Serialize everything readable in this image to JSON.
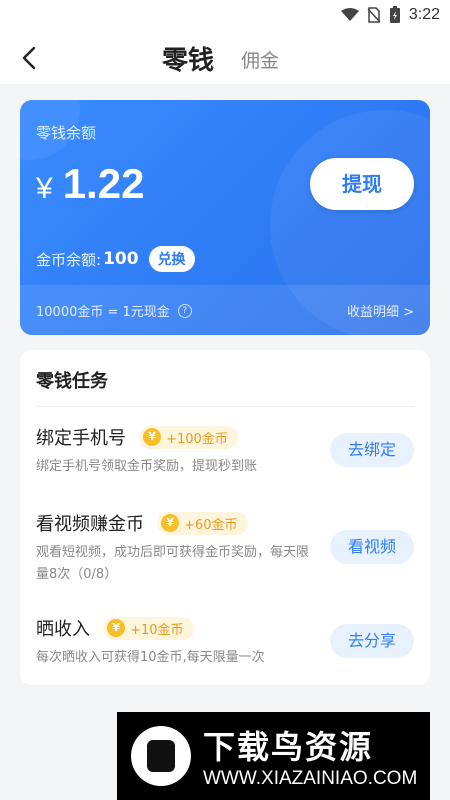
{
  "status_bar": {
    "time": "3:22",
    "icons": [
      "wifi-icon",
      "no-sim-icon",
      "battery-charging-icon"
    ]
  },
  "header": {
    "title": "零钱",
    "tab_commission": "佣金",
    "back_icon": "chevron-left-icon"
  },
  "balance_card": {
    "label": "零钱余额",
    "currency": "¥",
    "amount": "1.22",
    "withdraw_label": "提现",
    "coin_label": "金币余额:",
    "coin_value": "100",
    "exchange_label": "兑换",
    "rate_text": "10000金币 = 1元现金",
    "detail_link": "收益明细 >",
    "accent_color": "#2f7cf6"
  },
  "tasks": {
    "title": "零钱任务",
    "items": [
      {
        "name": "绑定手机号",
        "reward": "+100金币",
        "desc": "绑定手机号领取金币奖励，提现秒到账",
        "button": "去绑定"
      },
      {
        "name": "看视频赚金币",
        "reward": "+60金币",
        "desc": "观看短视频，成功后即可获得金币奖励，每天限量8次（0/8）",
        "button": "看视频"
      },
      {
        "name": "晒收入",
        "reward": "+10金币",
        "desc": "每次晒收入可获得10金币,每天限量一次",
        "button": "去分享"
      }
    ]
  },
  "watermark": {
    "title": "下载鸟资源",
    "url": "WWW.XIAZAINIAO.COM"
  }
}
